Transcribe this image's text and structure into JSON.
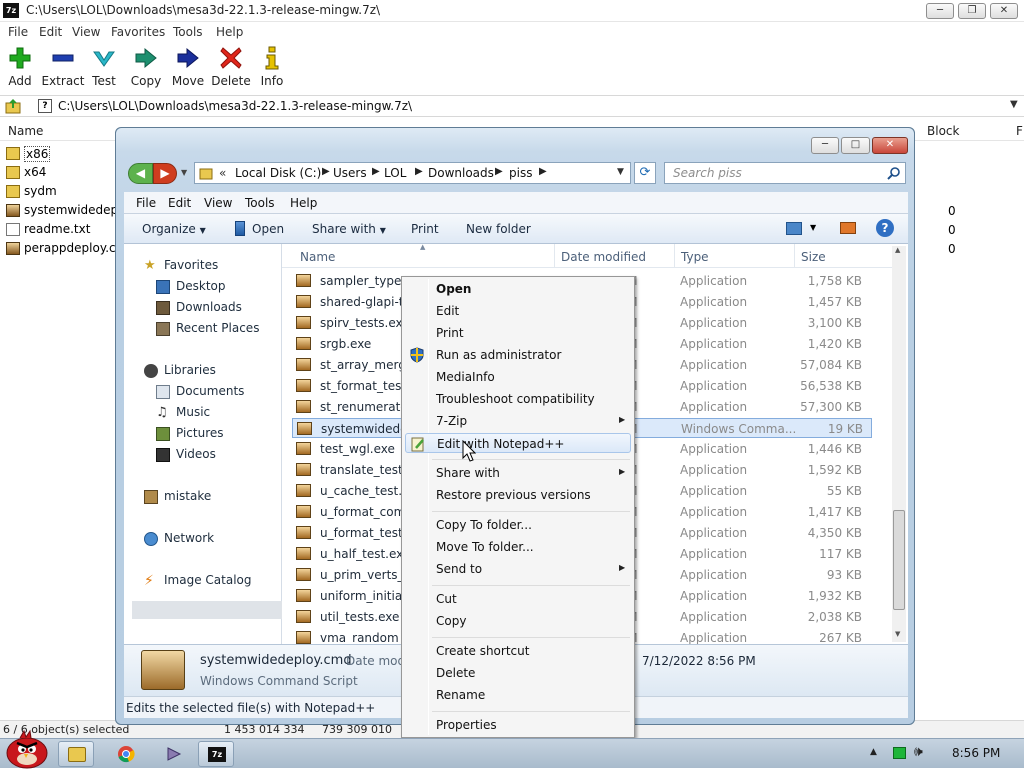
{
  "zip": {
    "app_icon": "7z",
    "title": "C:\\Users\\LOL\\Downloads\\mesa3d-22.1.3-release-mingw.7z\\",
    "menu": [
      "File",
      "Edit",
      "View",
      "Favorites",
      "Tools",
      "Help"
    ],
    "toolbar": [
      {
        "label": "Add",
        "icon": "plus-icon",
        "color": "#1faa1f"
      },
      {
        "label": "Extract",
        "icon": "minus-icon",
        "color": "#1f3fb0"
      },
      {
        "label": "Test",
        "icon": "check-icon",
        "color": "#2ab7c8"
      },
      {
        "label": "Copy",
        "icon": "double-arrow-icon",
        "color": "#1d8f6f"
      },
      {
        "label": "Move",
        "icon": "arrow-right-icon",
        "color": "#1b2f9b"
      },
      {
        "label": "Delete",
        "icon": "x-icon",
        "color": "#e0261b"
      },
      {
        "label": "Info",
        "icon": "info-icon",
        "color": "#c8a100"
      }
    ],
    "path": "C:\\Users\\LOL\\Downloads\\mesa3d-22.1.3-release-mingw.7z\\",
    "columns": {
      "name": "Name",
      "block": "Block",
      "extra": "F"
    },
    "rows": [
      {
        "name": "x86",
        "icon": "folder-icon",
        "block": ""
      },
      {
        "name": "x64",
        "icon": "folder-icon",
        "block": ""
      },
      {
        "name": "sydm",
        "icon": "folder-icon",
        "block": ""
      },
      {
        "name": "systemwidedeploy",
        "icon": "cmd-file-icon",
        "block": "0"
      },
      {
        "name": "readme.txt",
        "icon": "text-file-icon",
        "block": "0"
      },
      {
        "name": "perappdeploy.cmd",
        "icon": "cmd-file-icon",
        "block": "0"
      }
    ],
    "status": "6 / 6 object(s) selected",
    "status_size1": "1 453 014 334",
    "status_size2": "739 309 010"
  },
  "explorer": {
    "window_buttons": {
      "minimize": "─",
      "maximize": "□",
      "close": "✕"
    },
    "breadcrumb": [
      "Local Disk (C:)",
      "Users",
      "LOL",
      "Downloads",
      "piss"
    ],
    "search_placeholder": "Search piss",
    "menu": [
      "File",
      "Edit",
      "View",
      "Tools",
      "Help"
    ],
    "commands": {
      "organize": "Organize",
      "open": "Open",
      "share": "Share with",
      "print": "Print",
      "new_folder": "New folder"
    },
    "nav": {
      "favorites": "Favorites",
      "favorites_items": [
        "Desktop",
        "Downloads",
        "Recent Places"
      ],
      "libraries": "Libraries",
      "libraries_items": [
        "Documents",
        "Music",
        "Pictures",
        "Videos"
      ],
      "homegroup": "mistake",
      "network": "Network",
      "image_catalog": "Image Catalog"
    },
    "columns": {
      "name": "Name",
      "date": "Date modified",
      "type": "Type",
      "size": "Size"
    },
    "files": [
      {
        "name": "sampler_types_test.exe",
        "date": "AM",
        "type": "Application",
        "size": "1,758 KB"
      },
      {
        "name": "shared-glapi-test.exe",
        "date": "AM",
        "type": "Application",
        "size": "1,457 KB"
      },
      {
        "name": "spirv_tests.exe",
        "date": "AM",
        "type": "Application",
        "size": "3,100 KB"
      },
      {
        "name": "srgb.exe",
        "date": "AM",
        "type": "Application",
        "size": "1,420 KB"
      },
      {
        "name": "st_array_merge_test.exe",
        "date": "AM",
        "type": "Application",
        "size": "57,084 KB"
      },
      {
        "name": "st_format_test.exe",
        "date": "AM",
        "type": "Application",
        "size": "56,538 KB"
      },
      {
        "name": "st_renumerate_test.exe",
        "date": "AM",
        "type": "Application",
        "size": "57,300 KB"
      },
      {
        "name": "systemwidedeploy.cmd",
        "date": "PM",
        "type": "Windows Comma...",
        "size": "19 KB",
        "selected": true
      },
      {
        "name": "test_wgl.exe",
        "date": "AM",
        "type": "Application",
        "size": "1,446 KB"
      },
      {
        "name": "translate_test.exe",
        "date": "AM",
        "type": "Application",
        "size": "1,592 KB"
      },
      {
        "name": "u_cache_test.exe",
        "date": "AM",
        "type": "Application",
        "size": "55 KB"
      },
      {
        "name": "u_format_compatible_test.exe",
        "date": "AM",
        "type": "Application",
        "size": "1,417 KB"
      },
      {
        "name": "u_format_test.exe",
        "date": "AM",
        "type": "Application",
        "size": "4,350 KB"
      },
      {
        "name": "u_half_test.exe",
        "date": "AM",
        "type": "Application",
        "size": "117 KB"
      },
      {
        "name": "u_prim_verts_test.exe",
        "date": "AM",
        "type": "Application",
        "size": "93 KB"
      },
      {
        "name": "uniform_initializer_test.exe",
        "date": "AM",
        "type": "Application",
        "size": "1,932 KB"
      },
      {
        "name": "util_tests.exe",
        "date": "AM",
        "type": "Application",
        "size": "2,038 KB"
      },
      {
        "name": "vma_random_test.exe",
        "date": "AM",
        "type": "Application",
        "size": "267 KB"
      }
    ],
    "details": {
      "name": "systemwidedeploy.cmd",
      "type": "Windows Command Script",
      "date_label": "Date modified:",
      "date_value": "7/12/2022 8:56 PM"
    },
    "status": "Edits the selected file(s) with Notepad++"
  },
  "context_menu": {
    "items": [
      {
        "label": "Open",
        "bold": true
      },
      {
        "label": "Edit"
      },
      {
        "label": "Print"
      },
      {
        "label": "Run as administrator",
        "icon": "uac-shield-icon"
      },
      {
        "label": "MediaInfo"
      },
      {
        "label": "Troubleshoot compatibility"
      },
      {
        "label": "7-Zip",
        "submenu": true
      },
      {
        "label": "Edit with Notepad++",
        "icon": "notepad-plus-plus-icon",
        "highlighted": true
      },
      {
        "separator": true
      },
      {
        "label": "Share with",
        "submenu": true
      },
      {
        "label": "Restore previous versions"
      },
      {
        "separator": true
      },
      {
        "label": "Copy To folder..."
      },
      {
        "label": "Move To folder..."
      },
      {
        "label": "Send to",
        "submenu": true
      },
      {
        "separator": true
      },
      {
        "label": "Cut"
      },
      {
        "label": "Copy"
      },
      {
        "separator": true
      },
      {
        "label": "Create shortcut"
      },
      {
        "label": "Delete"
      },
      {
        "label": "Rename"
      },
      {
        "separator": true
      },
      {
        "label": "Properties"
      }
    ]
  },
  "taskbar": {
    "buttons": [
      "folder-icon",
      "chrome-icon",
      "app-icon",
      "7zip-icon"
    ],
    "time": "8:56 PM"
  }
}
